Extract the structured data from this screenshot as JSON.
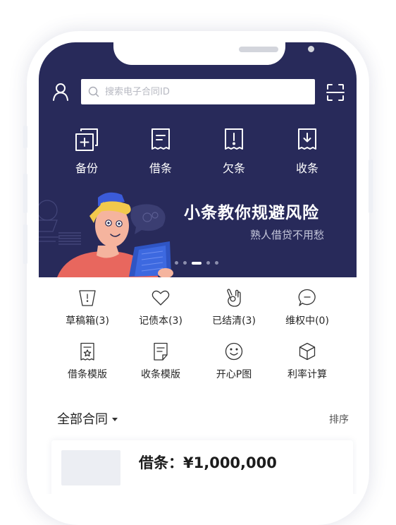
{
  "search": {
    "placeholder": "搜索电子合同ID"
  },
  "quick_actions": [
    {
      "label": "备份",
      "icon": "backup-plus-icon"
    },
    {
      "label": "借条",
      "icon": "iou-document-icon"
    },
    {
      "label": "欠条",
      "icon": "debt-exclamation-icon"
    },
    {
      "label": "收条",
      "icon": "receipt-download-icon"
    }
  ],
  "banner": {
    "title": "小条教你规避风险",
    "subtitle": "熟人借贷不用愁",
    "slide_count": 5,
    "active_slide": 3
  },
  "features": [
    {
      "label": "草稿箱(3)",
      "icon": "draft-box-icon"
    },
    {
      "label": "记债本(3)",
      "icon": "heart-icon"
    },
    {
      "label": "已结清(3)",
      "icon": "ok-hand-icon"
    },
    {
      "label": "维权中(0)",
      "icon": "chat-bubble-icon"
    },
    {
      "label": "借条模版",
      "icon": "iou-template-icon"
    },
    {
      "label": "收条模版",
      "icon": "receipt-template-icon"
    },
    {
      "label": "开心P图",
      "icon": "smile-icon"
    },
    {
      "label": "利率计算",
      "icon": "cube-icon"
    }
  ],
  "contracts": {
    "filter_label": "全部合同",
    "sort_label": "排序",
    "items": [
      {
        "title": "借条：¥1,000,000"
      }
    ]
  },
  "colors": {
    "hero_background": "#282a5a",
    "accent_yellow": "#f2c94c",
    "accent_red": "#e8675e"
  }
}
